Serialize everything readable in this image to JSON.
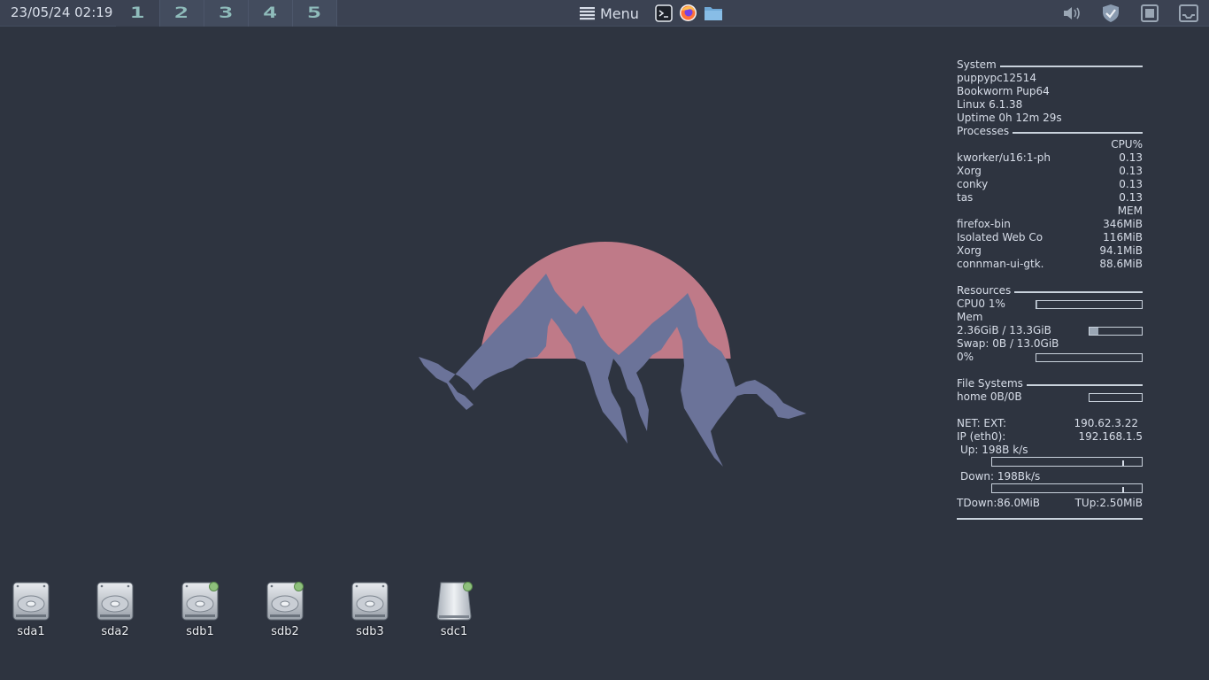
{
  "panel": {
    "clock": "23/05/24 02:19",
    "workspaces": [
      {
        "label": "1",
        "active": true
      },
      {
        "label": "2",
        "active": false
      },
      {
        "label": "3",
        "active": false
      },
      {
        "label": "4",
        "active": false
      },
      {
        "label": "5",
        "active": false
      }
    ],
    "menu_label": "Menu",
    "launchers": [
      "terminal-icon",
      "firefox-icon",
      "file-manager-icon"
    ],
    "tray": [
      "volume-icon",
      "shield-icon",
      "window-icon",
      "network-icon"
    ]
  },
  "conky": {
    "system": {
      "header": "System",
      "hostname": "puppypc12514",
      "distro": "Bookworm Pup64",
      "kernel": "Linux 6.1.38",
      "uptime": "Uptime 0h 12m 29s"
    },
    "processes": {
      "header": "Processes",
      "cpu_header": "CPU%",
      "cpu": [
        {
          "name": "kworker/u16:1-ph",
          "value": "0.13"
        },
        {
          "name": "Xorg",
          "value": "0.13"
        },
        {
          "name": "conky",
          "value": "0.13"
        },
        {
          "name": "tas",
          "value": "0.13"
        }
      ],
      "mem_header": "MEM",
      "mem": [
        {
          "name": "firefox-bin",
          "value": "346MiB"
        },
        {
          "name": "Isolated Web Co",
          "value": "116MiB"
        },
        {
          "name": "Xorg",
          "value": "94.1MiB"
        },
        {
          "name": "connman-ui-gtk.",
          "value": "88.6MiB"
        }
      ]
    },
    "resources": {
      "header": "Resources",
      "cpu_label": "CPU0 1%",
      "cpu_level": 0.01,
      "mem_label": "Mem",
      "mem_value": "2.36GiB / 13.3GiB",
      "mem_level": 0.177,
      "swap_label": "Swap: 0B / 13.0GiB",
      "swap_percent": "0%",
      "swap_level": 0
    },
    "filesystems": {
      "header": "File Systems",
      "home_label": "home 0B/0B",
      "home_level": 0
    },
    "net": {
      "ext_label": "NET: EXT:",
      "ext_ip": "190.62.3.22",
      "ip_label": "IP (eth0):",
      "ip": "192.168.1.5",
      "up_label": "Up: 198B k/s",
      "down_label": "Down: 198Bk/s",
      "tdown": "TDown:86.0MiB",
      "tup": "TUp:2.50MiB"
    }
  },
  "desktop": {
    "drives": [
      {
        "label": "sda1",
        "type": "hdd",
        "mounted": false
      },
      {
        "label": "sda2",
        "type": "hdd",
        "mounted": false
      },
      {
        "label": "sdb1",
        "type": "hdd",
        "mounted": true
      },
      {
        "label": "sdb2",
        "type": "hdd",
        "mounted": true
      },
      {
        "label": "sdb3",
        "type": "hdd",
        "mounted": false
      },
      {
        "label": "sdc1",
        "type": "usb",
        "mounted": true
      }
    ]
  },
  "colors": {
    "background": "#2e3440",
    "panel": "#3b4252",
    "sun": "#bf616a",
    "mountain": "#6b7399",
    "accent": "#8fbcbb"
  }
}
